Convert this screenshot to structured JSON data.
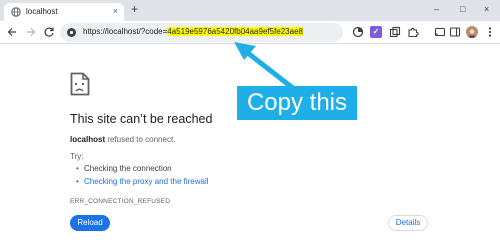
{
  "tab": {
    "title": "localhost",
    "close_glyph": "×",
    "new_tab_glyph": "+"
  },
  "window_controls": {
    "minimize": "–",
    "maximize": "□",
    "close": "×"
  },
  "omnibox": {
    "url_prefix": "https://localhost/?code=",
    "code": "4a519e5976a5420fb04aa9ef5fe23ae8"
  },
  "annotation": {
    "label": "Copy this",
    "color": "#1eaee8",
    "highlight_color": "#ffff00"
  },
  "error_page": {
    "title": "This site can’t be reached",
    "host": "localhost",
    "message": " refused to connect.",
    "try_label": "Try:",
    "suggestions": [
      "Checking the connection",
      "Checking the proxy and the firewall"
    ],
    "error_code": "ERR_CONNECTION_REFUSED",
    "reload_label": "Reload",
    "details_label": "Details"
  },
  "colors": {
    "accent": "#1a73e8",
    "tabstrip": "#dfe3e8",
    "omnibox": "#edf0f3"
  }
}
